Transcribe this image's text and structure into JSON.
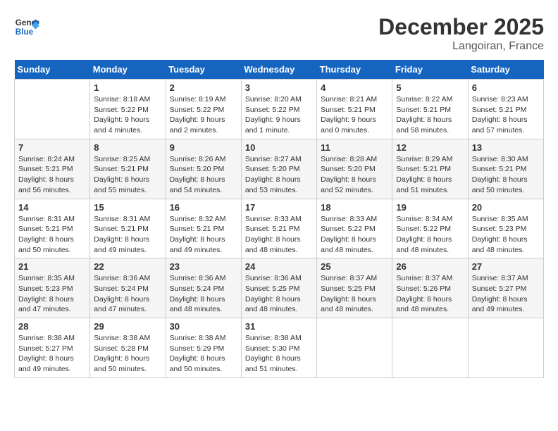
{
  "header": {
    "logo_line1": "General",
    "logo_line2": "Blue",
    "month": "December 2025",
    "location": "Langoiran, France"
  },
  "columns": [
    "Sunday",
    "Monday",
    "Tuesday",
    "Wednesday",
    "Thursday",
    "Friday",
    "Saturday"
  ],
  "weeks": [
    [
      {
        "day": "",
        "text": ""
      },
      {
        "day": "1",
        "text": "Sunrise: 8:18 AM\nSunset: 5:22 PM\nDaylight: 9 hours\nand 4 minutes."
      },
      {
        "day": "2",
        "text": "Sunrise: 8:19 AM\nSunset: 5:22 PM\nDaylight: 9 hours\nand 2 minutes."
      },
      {
        "day": "3",
        "text": "Sunrise: 8:20 AM\nSunset: 5:22 PM\nDaylight: 9 hours\nand 1 minute."
      },
      {
        "day": "4",
        "text": "Sunrise: 8:21 AM\nSunset: 5:21 PM\nDaylight: 9 hours\nand 0 minutes."
      },
      {
        "day": "5",
        "text": "Sunrise: 8:22 AM\nSunset: 5:21 PM\nDaylight: 8 hours\nand 58 minutes."
      },
      {
        "day": "6",
        "text": "Sunrise: 8:23 AM\nSunset: 5:21 PM\nDaylight: 8 hours\nand 57 minutes."
      }
    ],
    [
      {
        "day": "7",
        "text": "Sunrise: 8:24 AM\nSunset: 5:21 PM\nDaylight: 8 hours\nand 56 minutes."
      },
      {
        "day": "8",
        "text": "Sunrise: 8:25 AM\nSunset: 5:21 PM\nDaylight: 8 hours\nand 55 minutes."
      },
      {
        "day": "9",
        "text": "Sunrise: 8:26 AM\nSunset: 5:20 PM\nDaylight: 8 hours\nand 54 minutes."
      },
      {
        "day": "10",
        "text": "Sunrise: 8:27 AM\nSunset: 5:20 PM\nDaylight: 8 hours\nand 53 minutes."
      },
      {
        "day": "11",
        "text": "Sunrise: 8:28 AM\nSunset: 5:20 PM\nDaylight: 8 hours\nand 52 minutes."
      },
      {
        "day": "12",
        "text": "Sunrise: 8:29 AM\nSunset: 5:21 PM\nDaylight: 8 hours\nand 51 minutes."
      },
      {
        "day": "13",
        "text": "Sunrise: 8:30 AM\nSunset: 5:21 PM\nDaylight: 8 hours\nand 50 minutes."
      }
    ],
    [
      {
        "day": "14",
        "text": "Sunrise: 8:31 AM\nSunset: 5:21 PM\nDaylight: 8 hours\nand 50 minutes."
      },
      {
        "day": "15",
        "text": "Sunrise: 8:31 AM\nSunset: 5:21 PM\nDaylight: 8 hours\nand 49 minutes."
      },
      {
        "day": "16",
        "text": "Sunrise: 8:32 AM\nSunset: 5:21 PM\nDaylight: 8 hours\nand 49 minutes."
      },
      {
        "day": "17",
        "text": "Sunrise: 8:33 AM\nSunset: 5:21 PM\nDaylight: 8 hours\nand 48 minutes."
      },
      {
        "day": "18",
        "text": "Sunrise: 8:33 AM\nSunset: 5:22 PM\nDaylight: 8 hours\nand 48 minutes."
      },
      {
        "day": "19",
        "text": "Sunrise: 8:34 AM\nSunset: 5:22 PM\nDaylight: 8 hours\nand 48 minutes."
      },
      {
        "day": "20",
        "text": "Sunrise: 8:35 AM\nSunset: 5:23 PM\nDaylight: 8 hours\nand 48 minutes."
      }
    ],
    [
      {
        "day": "21",
        "text": "Sunrise: 8:35 AM\nSunset: 5:23 PM\nDaylight: 8 hours\nand 47 minutes."
      },
      {
        "day": "22",
        "text": "Sunrise: 8:36 AM\nSunset: 5:24 PM\nDaylight: 8 hours\nand 47 minutes."
      },
      {
        "day": "23",
        "text": "Sunrise: 8:36 AM\nSunset: 5:24 PM\nDaylight: 8 hours\nand 48 minutes."
      },
      {
        "day": "24",
        "text": "Sunrise: 8:36 AM\nSunset: 5:25 PM\nDaylight: 8 hours\nand 48 minutes."
      },
      {
        "day": "25",
        "text": "Sunrise: 8:37 AM\nSunset: 5:25 PM\nDaylight: 8 hours\nand 48 minutes."
      },
      {
        "day": "26",
        "text": "Sunrise: 8:37 AM\nSunset: 5:26 PM\nDaylight: 8 hours\nand 48 minutes."
      },
      {
        "day": "27",
        "text": "Sunrise: 8:37 AM\nSunset: 5:27 PM\nDaylight: 8 hours\nand 49 minutes."
      }
    ],
    [
      {
        "day": "28",
        "text": "Sunrise: 8:38 AM\nSunset: 5:27 PM\nDaylight: 8 hours\nand 49 minutes."
      },
      {
        "day": "29",
        "text": "Sunrise: 8:38 AM\nSunset: 5:28 PM\nDaylight: 8 hours\nand 50 minutes."
      },
      {
        "day": "30",
        "text": "Sunrise: 8:38 AM\nSunset: 5:29 PM\nDaylight: 8 hours\nand 50 minutes."
      },
      {
        "day": "31",
        "text": "Sunrise: 8:38 AM\nSunset: 5:30 PM\nDaylight: 8 hours\nand 51 minutes."
      },
      {
        "day": "",
        "text": ""
      },
      {
        "day": "",
        "text": ""
      },
      {
        "day": "",
        "text": ""
      }
    ]
  ]
}
